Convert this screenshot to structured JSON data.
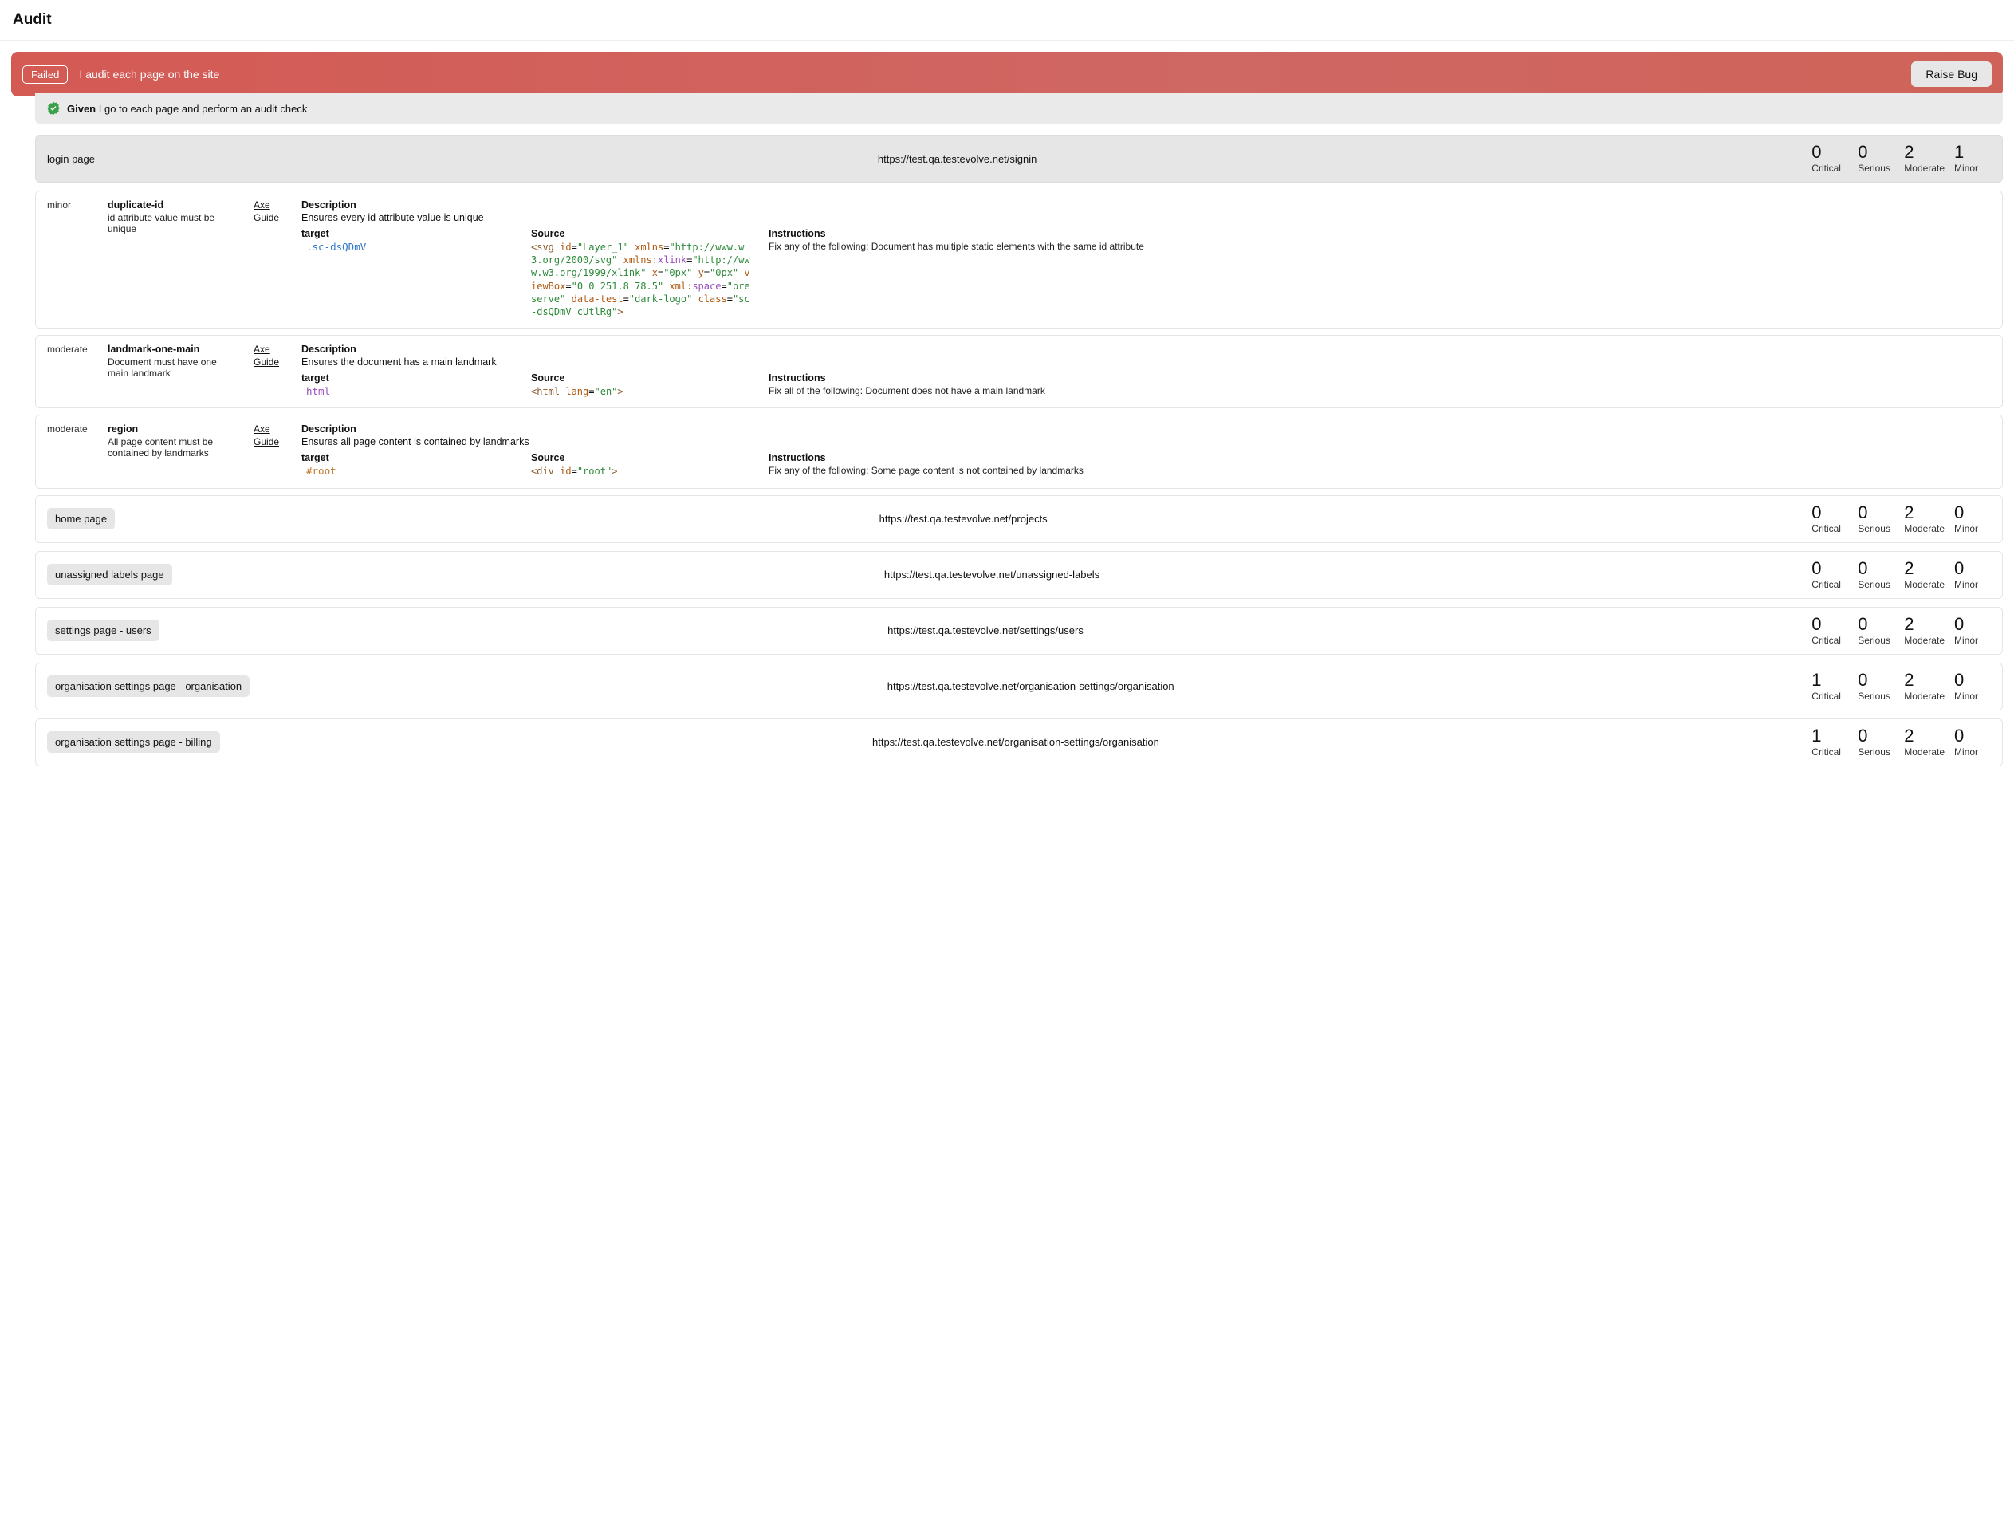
{
  "title": "Audit",
  "banner": {
    "status_label": "Failed",
    "text": "I audit each page on the site",
    "button": "Raise Bug"
  },
  "given": {
    "keyword": "Given",
    "text": "I go to each page and perform an audit check"
  },
  "severity_labels": {
    "critical": "Critical",
    "serious": "Serious",
    "moderate": "Moderate",
    "minor": "Minor"
  },
  "expanded_page": {
    "name": "login page",
    "url": "https://test.qa.testevolve.net/signin",
    "counts": {
      "critical": 0,
      "serious": 0,
      "moderate": 2,
      "minor": 1
    }
  },
  "link_labels": {
    "axe": "Axe",
    "guide": "Guide"
  },
  "section_labels": {
    "description": "Description",
    "target": "target",
    "source": "Source",
    "instructions": "Instructions"
  },
  "issues": [
    {
      "severity": "minor",
      "rule_id": "duplicate-id",
      "rule_help": "id attribute value must be unique",
      "description": "Ensures every id attribute value is unique",
      "target_text": ".sc-dsQDmV",
      "target_class": "target-code",
      "instructions": "Fix any of the following: Document has multiple static elements with the same id attribute",
      "source_tokens": [
        {
          "t": "<",
          "c": "tok-tag"
        },
        {
          "t": "svg ",
          "c": "tok-tag"
        },
        {
          "t": "id",
          "c": "tok-attr"
        },
        {
          "t": "=",
          "c": ""
        },
        {
          "t": "\"Layer_1\"",
          "c": "tok-str"
        },
        {
          "t": " ",
          "c": ""
        },
        {
          "t": "xmlns",
          "c": "tok-attr"
        },
        {
          "t": "=",
          "c": ""
        },
        {
          "t": "\"http://www.w3.org/2000/svg\"",
          "c": "tok-str"
        },
        {
          "t": " ",
          "c": ""
        },
        {
          "t": "xmlns:",
          "c": "tok-attr"
        },
        {
          "t": "xlink",
          "c": "tok-ns"
        },
        {
          "t": "=",
          "c": ""
        },
        {
          "t": "\"http://www.w3.org/1999/xlink\"",
          "c": "tok-str"
        },
        {
          "t": " ",
          "c": ""
        },
        {
          "t": "x",
          "c": "tok-attr"
        },
        {
          "t": "=",
          "c": ""
        },
        {
          "t": "\"0px\"",
          "c": "tok-str"
        },
        {
          "t": " ",
          "c": ""
        },
        {
          "t": "y",
          "c": "tok-attr"
        },
        {
          "t": "=",
          "c": ""
        },
        {
          "t": "\"0px\"",
          "c": "tok-str"
        },
        {
          "t": " ",
          "c": ""
        },
        {
          "t": "viewBox",
          "c": "tok-attr"
        },
        {
          "t": "=",
          "c": ""
        },
        {
          "t": "\"0 0 251.8 78.5\"",
          "c": "tok-str"
        },
        {
          "t": " ",
          "c": ""
        },
        {
          "t": "xml:",
          "c": "tok-attr"
        },
        {
          "t": "space",
          "c": "tok-ns"
        },
        {
          "t": "=",
          "c": ""
        },
        {
          "t": "\"preserve\"",
          "c": "tok-str"
        },
        {
          "t": " ",
          "c": ""
        },
        {
          "t": "data-test",
          "c": "tok-attr"
        },
        {
          "t": "=",
          "c": ""
        },
        {
          "t": "\"dark-logo\"",
          "c": "tok-str"
        },
        {
          "t": " ",
          "c": ""
        },
        {
          "t": "class",
          "c": "tok-attr"
        },
        {
          "t": "=",
          "c": ""
        },
        {
          "t": "\"sc-dsQDmV cUtlRg\"",
          "c": "tok-str"
        },
        {
          "t": ">",
          "c": "tok-tag"
        }
      ]
    },
    {
      "severity": "moderate",
      "rule_id": "landmark-one-main",
      "rule_help": "Document must have one main landmark",
      "description": "Ensures the document has a main landmark",
      "target_text": "html",
      "target_class": "target-code html-kw",
      "instructions": "Fix all of the following: Document does not have a main landmark",
      "source_tokens": [
        {
          "t": "<",
          "c": "tok-tag"
        },
        {
          "t": "html ",
          "c": "tok-tag"
        },
        {
          "t": "lang",
          "c": "tok-attr"
        },
        {
          "t": "=",
          "c": ""
        },
        {
          "t": "\"en\"",
          "c": "tok-str"
        },
        {
          "t": ">",
          "c": "tok-tag"
        }
      ]
    },
    {
      "severity": "moderate",
      "rule_id": "region",
      "rule_help": "All page content must be contained by landmarks",
      "description": "Ensures all page content is contained by landmarks",
      "target_text": "#root",
      "target_class": "target-code id-sel",
      "instructions": "Fix any of the following: Some page content is not contained by landmarks",
      "source_tokens": [
        {
          "t": "<",
          "c": "tok-tag"
        },
        {
          "t": "div ",
          "c": "tok-tag"
        },
        {
          "t": "id",
          "c": "tok-attr"
        },
        {
          "t": "=",
          "c": ""
        },
        {
          "t": "\"root\"",
          "c": "tok-str"
        },
        {
          "t": ">",
          "c": "tok-tag"
        }
      ]
    }
  ],
  "collapsed_pages": [
    {
      "name": "home page",
      "url": "https://test.qa.testevolve.net/projects",
      "counts": {
        "critical": 0,
        "serious": 0,
        "moderate": 2,
        "minor": 0
      }
    },
    {
      "name": "unassigned labels page",
      "url": "https://test.qa.testevolve.net/unassigned-labels",
      "counts": {
        "critical": 0,
        "serious": 0,
        "moderate": 2,
        "minor": 0
      }
    },
    {
      "name": "settings page - users",
      "url": "https://test.qa.testevolve.net/settings/users",
      "counts": {
        "critical": 0,
        "serious": 0,
        "moderate": 2,
        "minor": 0
      }
    },
    {
      "name": "organisation settings page - organisation",
      "url": "https://test.qa.testevolve.net/organisation-settings/organisation",
      "counts": {
        "critical": 1,
        "serious": 0,
        "moderate": 2,
        "minor": 0
      }
    },
    {
      "name": "organisation settings page - billing",
      "url": "https://test.qa.testevolve.net/organisation-settings/organisation",
      "counts": {
        "critical": 1,
        "serious": 0,
        "moderate": 2,
        "minor": 0
      }
    }
  ]
}
